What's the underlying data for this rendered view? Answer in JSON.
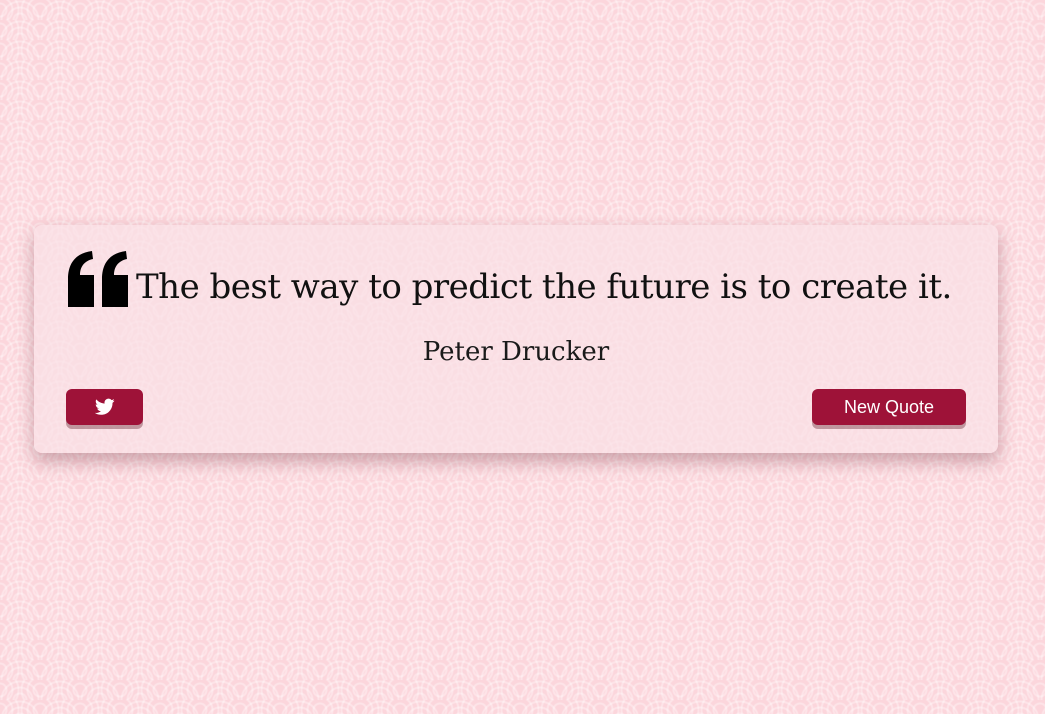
{
  "quote": {
    "text": "The best way to predict the future is to create it.",
    "author": "Peter Drucker",
    "icon": "quote-left-icon"
  },
  "actions": {
    "tweet_icon": "twitter-icon",
    "new_quote_label": "New Quote"
  },
  "colors": {
    "background": "#fcd6dc",
    "button": "#9e1238",
    "text": "#111111"
  }
}
